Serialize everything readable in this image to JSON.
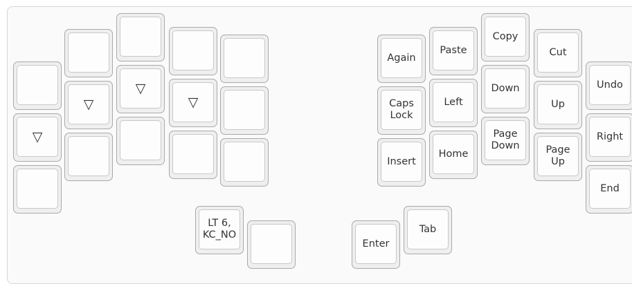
{
  "layout_title": "",
  "keys": [
    {
      "label": ""
    },
    {
      "label": "▽"
    },
    {
      "label": ""
    },
    {
      "label": ""
    },
    {
      "label": "▽"
    },
    {
      "label": ""
    },
    {
      "label": ""
    },
    {
      "label": "▽"
    },
    {
      "label": ""
    },
    {
      "label": ""
    },
    {
      "label": "▽"
    },
    {
      "label": ""
    },
    {
      "label": ""
    },
    {
      "label": ""
    },
    {
      "label": ""
    },
    {
      "label": "Again"
    },
    {
      "label": "Caps\nLock"
    },
    {
      "label": "Insert"
    },
    {
      "label": "Paste"
    },
    {
      "label": "Left"
    },
    {
      "label": "Home"
    },
    {
      "label": "Copy"
    },
    {
      "label": "Down"
    },
    {
      "label": "Page\nDown"
    },
    {
      "label": "Cut"
    },
    {
      "label": "Up"
    },
    {
      "label": "Page\nUp"
    },
    {
      "label": "Undo"
    },
    {
      "label": "Right"
    },
    {
      "label": "End"
    },
    {
      "label": "LT 6,\nKC_NO"
    },
    {
      "label": ""
    },
    {
      "label": "Enter"
    },
    {
      "label": "Tab"
    }
  ],
  "colors": {
    "cap_face": "#fdfdfd",
    "cap_border": "#a9a9a9",
    "board_bg": "#fafafa"
  }
}
